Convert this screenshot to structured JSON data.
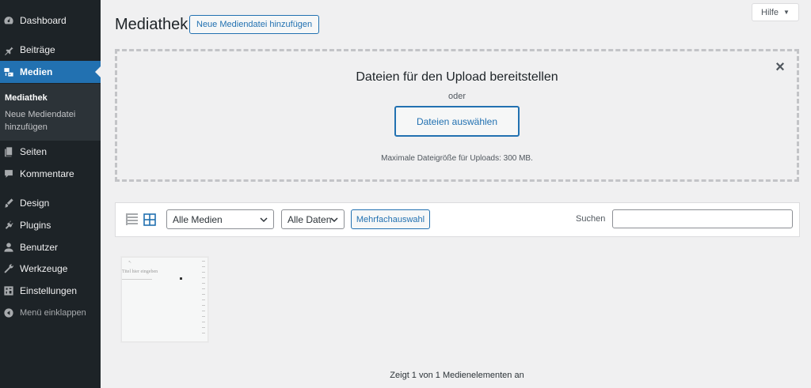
{
  "sidebar": {
    "items": [
      {
        "label": "Dashboard",
        "icon": "dashboard-icon"
      },
      {
        "label": "Beiträge",
        "icon": "pin-icon"
      },
      {
        "label": "Medien",
        "icon": "media-icon",
        "active": true
      },
      {
        "label": "Seiten",
        "icon": "pages-icon"
      },
      {
        "label": "Kommentare",
        "icon": "comment-icon"
      },
      {
        "label": "Design",
        "icon": "brush-icon"
      },
      {
        "label": "Plugins",
        "icon": "plug-icon"
      },
      {
        "label": "Benutzer",
        "icon": "user-icon"
      },
      {
        "label": "Werkzeuge",
        "icon": "wrench-icon"
      },
      {
        "label": "Einstellungen",
        "icon": "settings-icon"
      }
    ],
    "submenu": {
      "current": "Mediathek",
      "add_new": "Neue Mediendatei hinzufügen"
    },
    "collapse_label": "Menü einklappen",
    "colors": {
      "background": "#1d2327",
      "active": "#2271b1",
      "submenu": "#2c3338"
    }
  },
  "header": {
    "title": "Mediathek",
    "add_new_button": "Neue Mediendatei hinzufügen",
    "help_tab": "Hilfe"
  },
  "uploader": {
    "title": "Dateien für den Upload bereitstellen",
    "or": "oder",
    "select_button": "Dateien auswählen",
    "max_size": "Maximale Dateigröße für Uploads: 300 MB.",
    "close_symbol": "×"
  },
  "toolbar": {
    "media_filter": "Alle Medien",
    "date_filter": "Alle Daten",
    "bulk_select": "Mehrfachauswahl",
    "search_label": "Suchen",
    "search_value": ""
  },
  "attachment": {
    "preview_title": "Titel hier eingeben"
  },
  "footer": {
    "count_text": "Zeigt 1 von 1 Medienelementen an"
  }
}
